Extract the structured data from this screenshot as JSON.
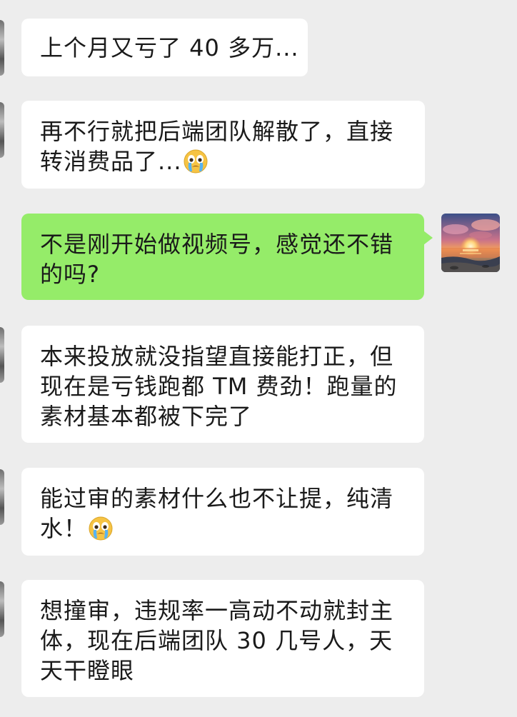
{
  "messages": [
    {
      "side": "in",
      "lines": [
        "上个月又亏了 40 多万..."
      ],
      "emoji": null
    },
    {
      "side": "in",
      "lines": [
        "再不行就把后端团队解散了，直接",
        "转消费品了..."
      ],
      "emoji": "crying-face"
    },
    {
      "side": "out",
      "lines": [
        "不是刚开始做视频号，感觉还不错",
        "的吗?"
      ],
      "emoji": null
    },
    {
      "side": "in",
      "lines": [
        "本来投放就没指望直接能打正，但",
        "现在是亏钱跑都 TM 费劲！跑量的",
        "素材基本都被下完了"
      ],
      "emoji": null
    },
    {
      "side": "in",
      "lines": [
        "能过审的素材什么也不让提，纯清",
        "水！"
      ],
      "emoji": "crying-face"
    },
    {
      "side": "in",
      "lines": [
        "想撞审，违规率一高动不动就封主",
        "体，现在后端团队 30 几号人，天",
        "天干瞪眼"
      ],
      "emoji": null
    }
  ],
  "colors": {
    "background": "#ededed",
    "incoming_bubble": "#ffffff",
    "outgoing_bubble": "#95ec69",
    "text": "#1a1a1a"
  },
  "icons": {
    "emoji": "crying-face",
    "self_avatar": "sunset-beach-avatar"
  }
}
